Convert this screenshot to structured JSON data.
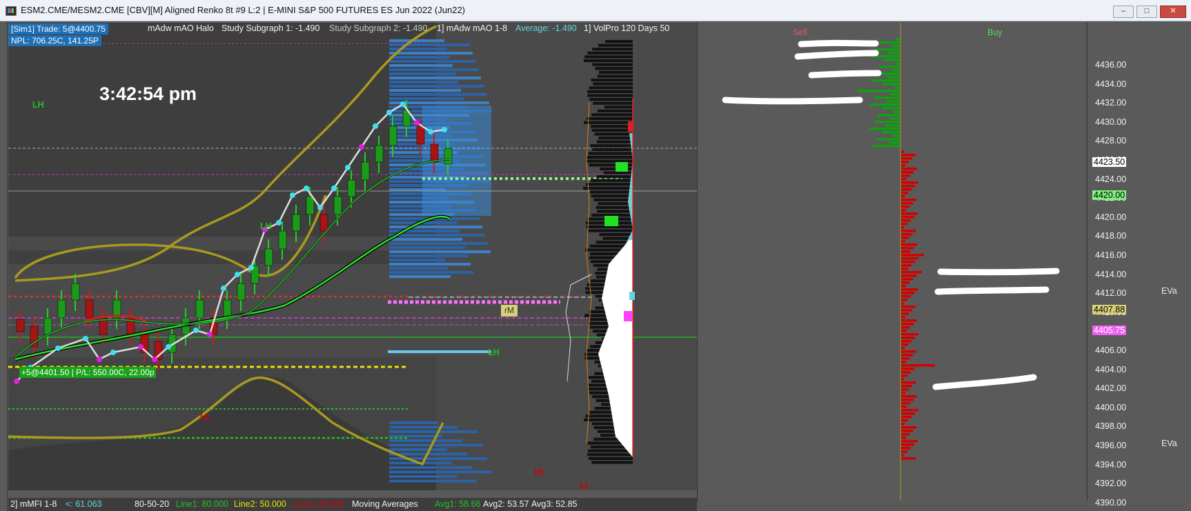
{
  "window": {
    "title": "ESM2.CME/MESM2.CME [CBV][M]  Aligned Renko 8t  #9 L:2 | E-MINI S&P 500 FUTURES ES Jun 2022 (Jun22)",
    "minimize_icon": "minimize-icon",
    "restore_icon": "restore-icon",
    "close_icon": "close-icon"
  },
  "header": {
    "sim_trade": "[Sim1]  Trade: 5@4400.75",
    "npl": "NPL: 706.25C, 141.25P",
    "study_name": "mAdw mAO Halo",
    "study_sub1": "Study Subgraph 1: -1.490",
    "study_sub2": "Study Subgraph 2: -1.490",
    "study2_name": "1] mAdw mAO 1-8",
    "average": "Average: -1.490",
    "volpro": "1] VolPro 120 Days 50"
  },
  "clock": "3:42:54 pm",
  "labels": {
    "lh1": "LH",
    "lh2": "LH",
    "lh3": "LH",
    "ll1": "LL",
    "ll2": "LL",
    "hl": "HL",
    "rm": "rM"
  },
  "position_label": "+5@4401.50 | P/L: 550.00C, 22.00p",
  "dom": {
    "sell_label": "Sell",
    "buy_label": "Buy"
  },
  "axis": {
    "prices": [
      "4436.00",
      "4434.00",
      "4432.00",
      "4430.00",
      "4428.00",
      "4426.00",
      "4424.00",
      "4422.00",
      "4420.00",
      "4418.00",
      "4416.00",
      "4414.00",
      "4412.00",
      "4410.00",
      "4408.00",
      "4406.00",
      "4404.00",
      "4402.00",
      "4400.00",
      "4398.00",
      "4396.00",
      "4394.00",
      "4392.00",
      "4390.00"
    ],
    "current_price": "4423.50",
    "green_price": "4420.00",
    "yellow_price": "4407.88",
    "pink_price": "4405.75",
    "eva_label": "EVa"
  },
  "bottom": {
    "indicator": "2] mMFI 1-8",
    "lt": "<: 61.063",
    "preset": "80-50-20",
    "line1": "Line1: 80.000",
    "line2": "Line2: 50.000",
    "line3": "Line3: 20.000",
    "ma": "Moving Averages",
    "avg1": "Avg1: 58.66",
    "avg2": "Avg2: 53.57",
    "avg3": "Avg3: 52.85"
  },
  "colors": {
    "cyan": "#5fd6e0",
    "green": "#22c322",
    "red": "#d40000",
    "yellow": "#e6e600",
    "olive": "#a89a1e",
    "blue_info": "#1f6fb5"
  }
}
